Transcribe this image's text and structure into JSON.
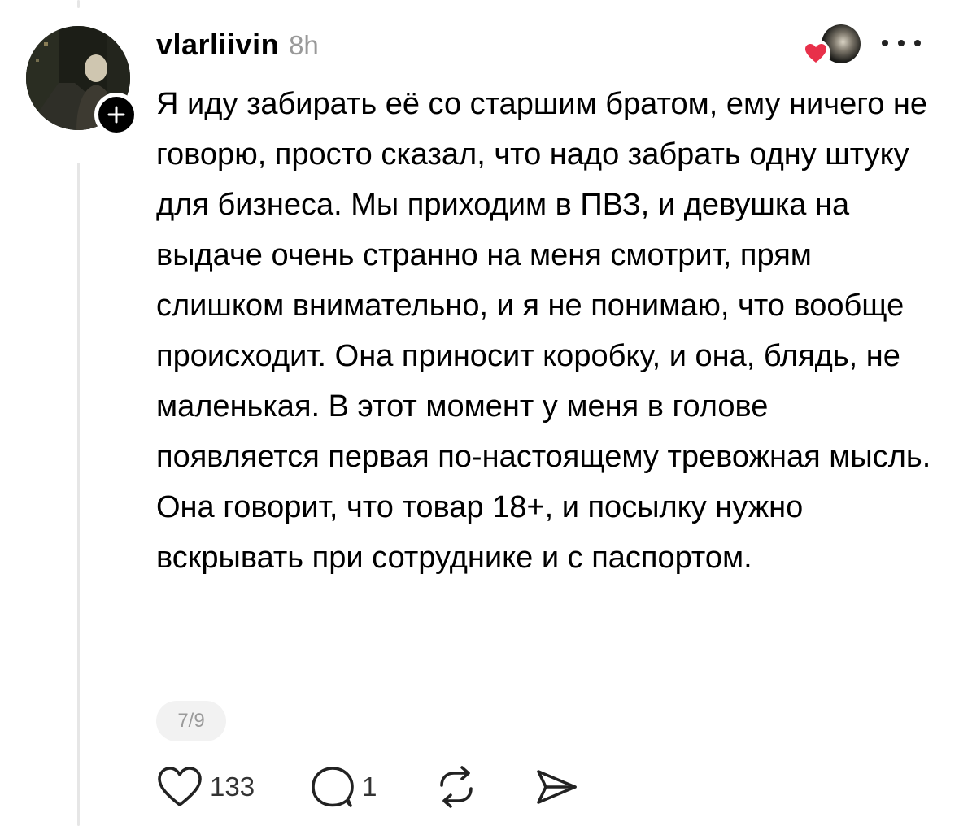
{
  "post": {
    "username": "vlarliivin",
    "time": "8h",
    "text": "Я иду забирать её со старшим братом, ему ничего не говорю, просто сказал, что надо забрать одну штуку для бизнеса. Мы приходим в ПВЗ, и девушка на выдаче очень странно на меня смотрит, прям слишком внимательно, и я не понимаю, что вообще происходит. Она приносит коробку, и она, блядь, не маленькая. В этот момент у меня в голове появляется первая по-настоящему тревожная мысль. Она говорит, что товар 18+, и посылку нужно вскрывать при сотруднике и с паспортом.",
    "page_indicator": "7/9"
  },
  "actions": {
    "like_count": "133",
    "reply_count": "1"
  },
  "icons": {
    "follow": "plus-icon",
    "liked_by": "heart-icon",
    "more": "ellipsis-icon",
    "like": "heart-outline-icon",
    "reply": "speech-bubble-icon",
    "repost": "repost-icon",
    "share": "send-icon"
  },
  "colors": {
    "heart_red": "#e8304a",
    "muted_text": "#999999",
    "thread_line": "#e6e6e6"
  }
}
